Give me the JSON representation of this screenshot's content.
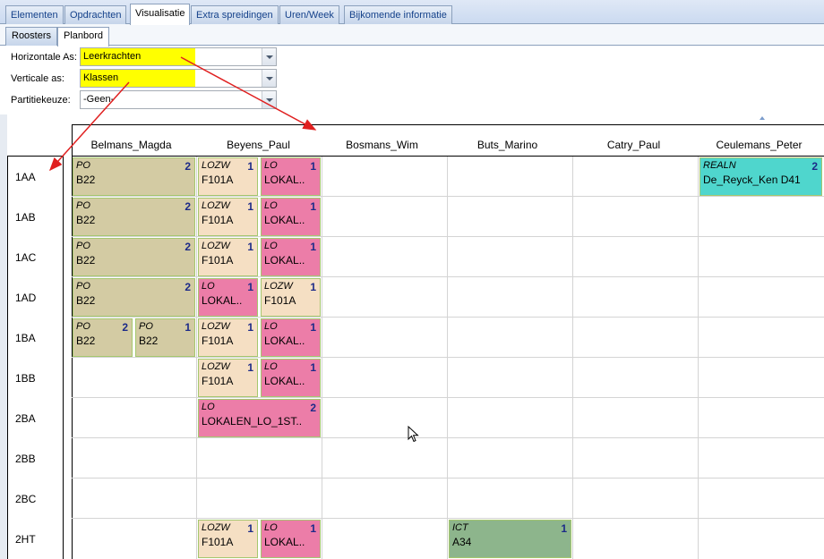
{
  "tabs": [
    "Elementen",
    "Opdrachten",
    "Visualisatie",
    "Extra spreidingen",
    "Uren/Week",
    "Bijkomende informatie"
  ],
  "subtabs": [
    "Roosters",
    "Planbord"
  ],
  "form": {
    "horizontal_label": "Horizontale As:",
    "horizontal_value": "Leerkrachten",
    "vertical_label": "Verticale as:",
    "vertical_value": "Klassen",
    "partition_label": "Partitiekeuze:",
    "partition_value": "-Geen-"
  },
  "columns": [
    "Belmans_Magda",
    "Beyens_Paul",
    "Bosmans_Wim",
    "Buts_Marino",
    "Catry_Paul",
    "Ceulemans_Peter"
  ],
  "rows": [
    "1AA",
    "1AB",
    "1AC",
    "1AD",
    "1BA",
    "1BB",
    "2BA",
    "2BB",
    "2BC",
    "2HT"
  ],
  "cards": [
    {
      "code": "PO",
      "num": "2",
      "room": "B22",
      "color": "#d3cba3"
    },
    {
      "code": "LOZW",
      "num": "1",
      "room": "F101A",
      "color": "#f5dfc3"
    },
    {
      "code": "LO",
      "num": "1",
      "room": "LOKAL..",
      "color": "#ec7da8"
    },
    {
      "code": "REALN",
      "num": "2",
      "room": "De_Reyck_Ken   D41",
      "color": "#4fd6cd"
    },
    {
      "code": "PO",
      "num": "2",
      "room": "B22",
      "color": "#d3cba3"
    },
    {
      "code": "LOZW",
      "num": "1",
      "room": "F101A",
      "color": "#f5dfc3"
    },
    {
      "code": "LO",
      "num": "1",
      "room": "LOKAL..",
      "color": "#ec7da8"
    },
    {
      "code": "PO",
      "num": "2",
      "room": "B22",
      "color": "#d3cba3"
    },
    {
      "code": "LOZW",
      "num": "1",
      "room": "F101A",
      "color": "#f5dfc3"
    },
    {
      "code": "LO",
      "num": "1",
      "room": "LOKAL..",
      "color": "#ec7da8"
    },
    {
      "code": "PO",
      "num": "2",
      "room": "B22",
      "color": "#d3cba3"
    },
    {
      "code": "LO",
      "num": "1",
      "room": "LOKAL..",
      "color": "#ec7da8"
    },
    {
      "code": "LOZW",
      "num": "1",
      "room": "F101A",
      "color": "#f5dfc3"
    },
    {
      "code": "PO",
      "num": "2",
      "room": "B22",
      "color": "#d3cba3"
    },
    {
      "code": "PO",
      "num": "1",
      "room": "B22",
      "color": "#d3cba3"
    },
    {
      "code": "LOZW",
      "num": "1",
      "room": "F101A",
      "color": "#f5dfc3"
    },
    {
      "code": "LO",
      "num": "1",
      "room": "LOKAL..",
      "color": "#ec7da8"
    },
    {
      "code": "LOZW",
      "num": "1",
      "room": "F101A",
      "color": "#f5dfc3"
    },
    {
      "code": "LO",
      "num": "1",
      "room": "LOKAL..",
      "color": "#ec7da8"
    },
    {
      "code": "LO",
      "num": "2",
      "room": "LOKALEN_LO_1ST..",
      "color": "#ec7da8"
    },
    {
      "code": "LOZW",
      "num": "1",
      "room": "F101A",
      "color": "#f5dfc3"
    },
    {
      "code": "LO",
      "num": "1",
      "room": "LOKAL..",
      "color": "#ec7da8"
    },
    {
      "code": "ICT",
      "num": "1",
      "room": "A34",
      "color": "#8db58c"
    }
  ],
  "annotation_color": "#e02020"
}
